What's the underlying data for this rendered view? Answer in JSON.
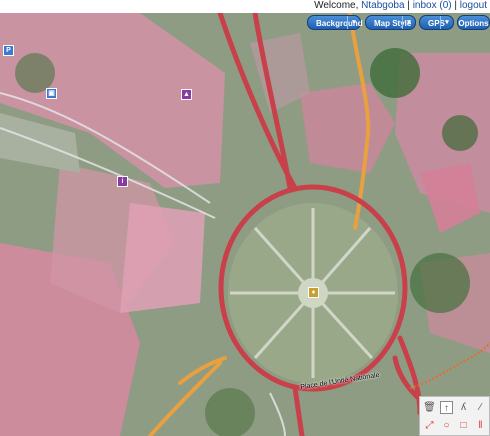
{
  "header": {
    "welcome_prefix": "Welcome, ",
    "username": "Ntabgoba",
    "separator1": " | ",
    "inbox": "inbox (0)",
    "separator2": " | ",
    "logout": "logout"
  },
  "map_toolbar": {
    "background": "Background",
    "map_style": "Map Style",
    "gps": "GPS",
    "options": "Options",
    "dropdown_glyph": "▾"
  },
  "map": {
    "street_label": "Place de l'Unité Nationale"
  },
  "toolbox": {
    "tools": [
      "trash-icon",
      "pointer-icon",
      "walk-icon",
      "link-icon",
      "resize-icon",
      "circle-icon",
      "square-icon",
      "vertical-icon"
    ]
  },
  "colors": {
    "road_primary": "#c8404a",
    "road_secondary": "#e8a040",
    "landuse_pink": "#d88aa0",
    "button_blue": "#2a6fc0"
  }
}
